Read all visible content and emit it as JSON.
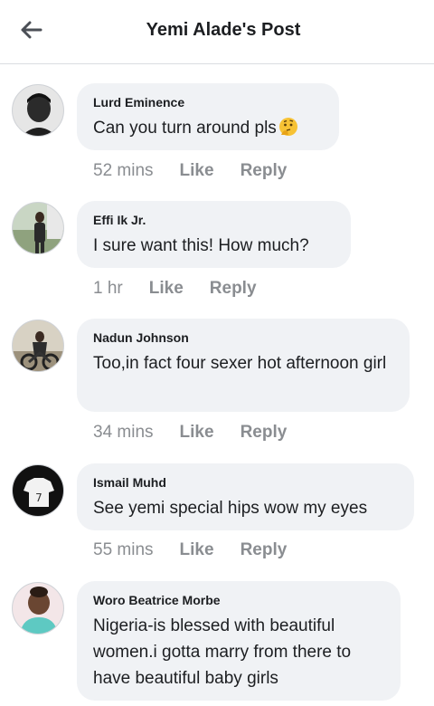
{
  "header": {
    "title": "Yemi Alade's Post",
    "back_icon": "back-arrow-icon"
  },
  "comments": [
    {
      "author": "Lurd Eminence",
      "text": "Can you turn around pls",
      "emoji": "thinking-face-emoji",
      "time": "52 mins",
      "like": "Like",
      "reply": "Reply"
    },
    {
      "author": "Effi Ik Jr.",
      "text": "I sure want this! How much?",
      "time": "1 hr",
      "like": "Like",
      "reply": "Reply"
    },
    {
      "author": "Nadun Johnson",
      "text": "Too,in fact four sexer hot afternoon girl",
      "time": "34 mins",
      "like": "Like",
      "reply": "Reply"
    },
    {
      "author": "Ismail Muhd",
      "text": "See yemi special hips wow my eyes",
      "time": "55 mins",
      "like": "Like",
      "reply": "Reply"
    },
    {
      "author": "Woro Beatrice Morbe",
      "text": "Nigeria-is blessed with beautiful women.i gotta marry from there to have beautiful baby girls"
    }
  ]
}
